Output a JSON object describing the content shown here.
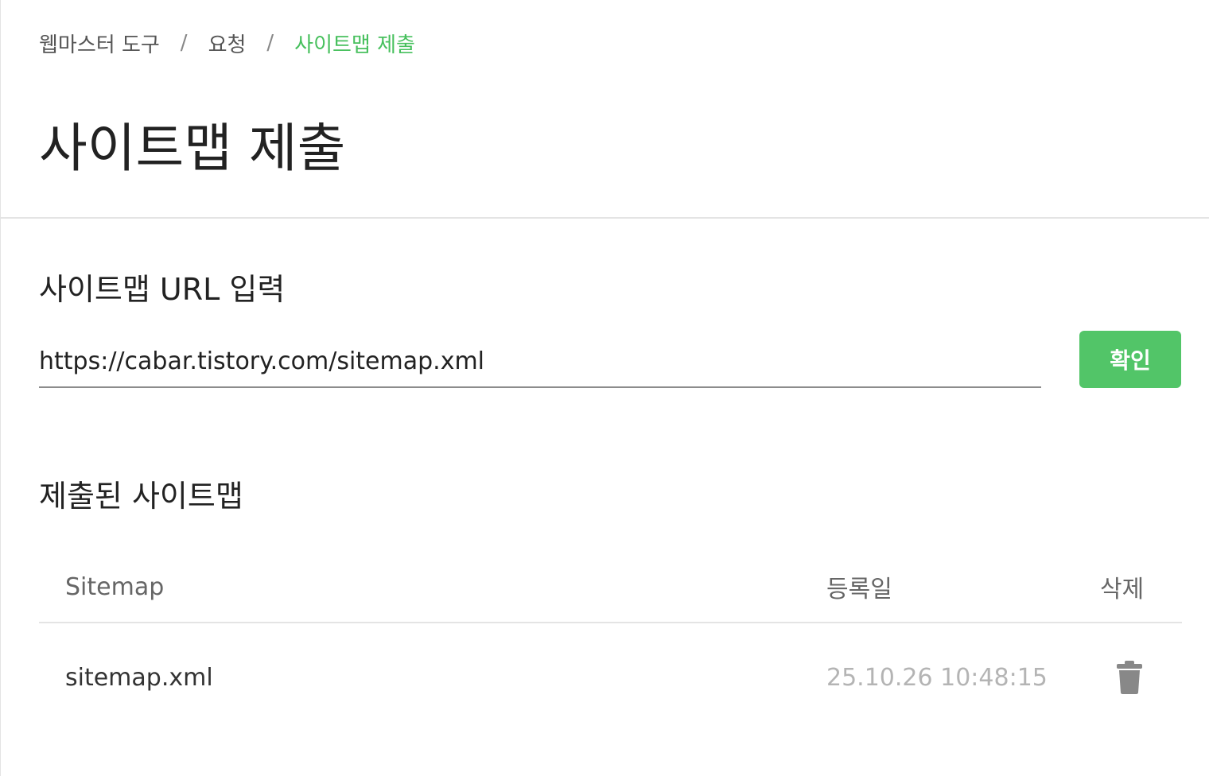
{
  "breadcrumb": {
    "items": [
      "웹마스터 도구",
      "요청",
      "사이트맵 제출"
    ],
    "separator": "/"
  },
  "page": {
    "title": "사이트맵 제출"
  },
  "url_section": {
    "title": "사이트맵 URL 입력",
    "input_value": "https://cabar.tistory.com/sitemap.xml",
    "confirm_label": "확인"
  },
  "list_section": {
    "title": "제출된 사이트맵",
    "columns": [
      "Sitemap",
      "등록일",
      "삭제"
    ],
    "rows": [
      {
        "sitemap": "sitemap.xml",
        "date": "25.10.26 10:48:15",
        "delete_icon": "trash-icon"
      }
    ]
  },
  "colors": {
    "accent": "#47c05d",
    "button": "#52c568",
    "text": "#222222",
    "muted": "#b4b4b4"
  }
}
